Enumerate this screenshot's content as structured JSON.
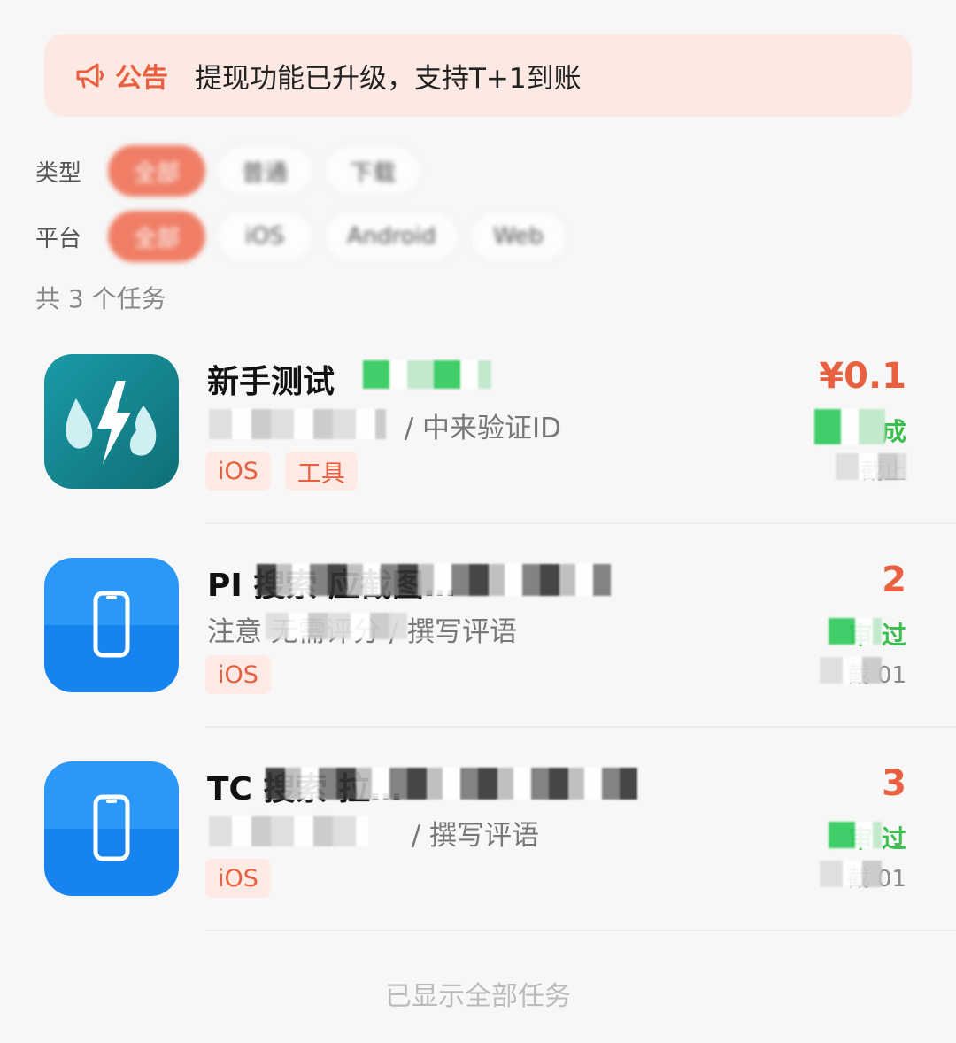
{
  "notice": {
    "label": "公告",
    "text": "提现功能已升级，支持T+1到账",
    "icon": "megaphone-icon"
  },
  "filters": {
    "type_label": "类型",
    "type_options": [
      "全部",
      "普通",
      "下载"
    ],
    "platform_label": "平台",
    "platform_options": [
      "全部",
      "iOS",
      "Android",
      "Web"
    ]
  },
  "count_text": "共 3 个任务",
  "tasks": [
    {
      "title": "新手测试",
      "subtitle": "/ 中来验证ID",
      "tags": [
        "iOS",
        "工具"
      ],
      "reward": "¥0.1",
      "status": "成",
      "deadline": "截止",
      "icon": "water-lightning-flame-app-icon"
    },
    {
      "title": "PI 搜索 应截图…",
      "subtitle": "注意 无需评分 / 撰写评语",
      "tags": [
        "iOS"
      ],
      "reward": "2",
      "status": "审 过",
      "deadline": "截 01",
      "icon": "phone-app-icon"
    },
    {
      "title": "TC 搜索 拉…",
      "subtitle": "/ 撰写评语",
      "tags": [
        "iOS"
      ],
      "reward": "3",
      "status": "审 过",
      "deadline": "截 01",
      "icon": "phone-app-icon"
    }
  ],
  "footer": "已显示全部任务",
  "colors": {
    "accent": "#ef6a4e",
    "notice_bg": "#fde9e4",
    "success": "#3bbf4f",
    "app_blue": "#1f8cf5"
  }
}
